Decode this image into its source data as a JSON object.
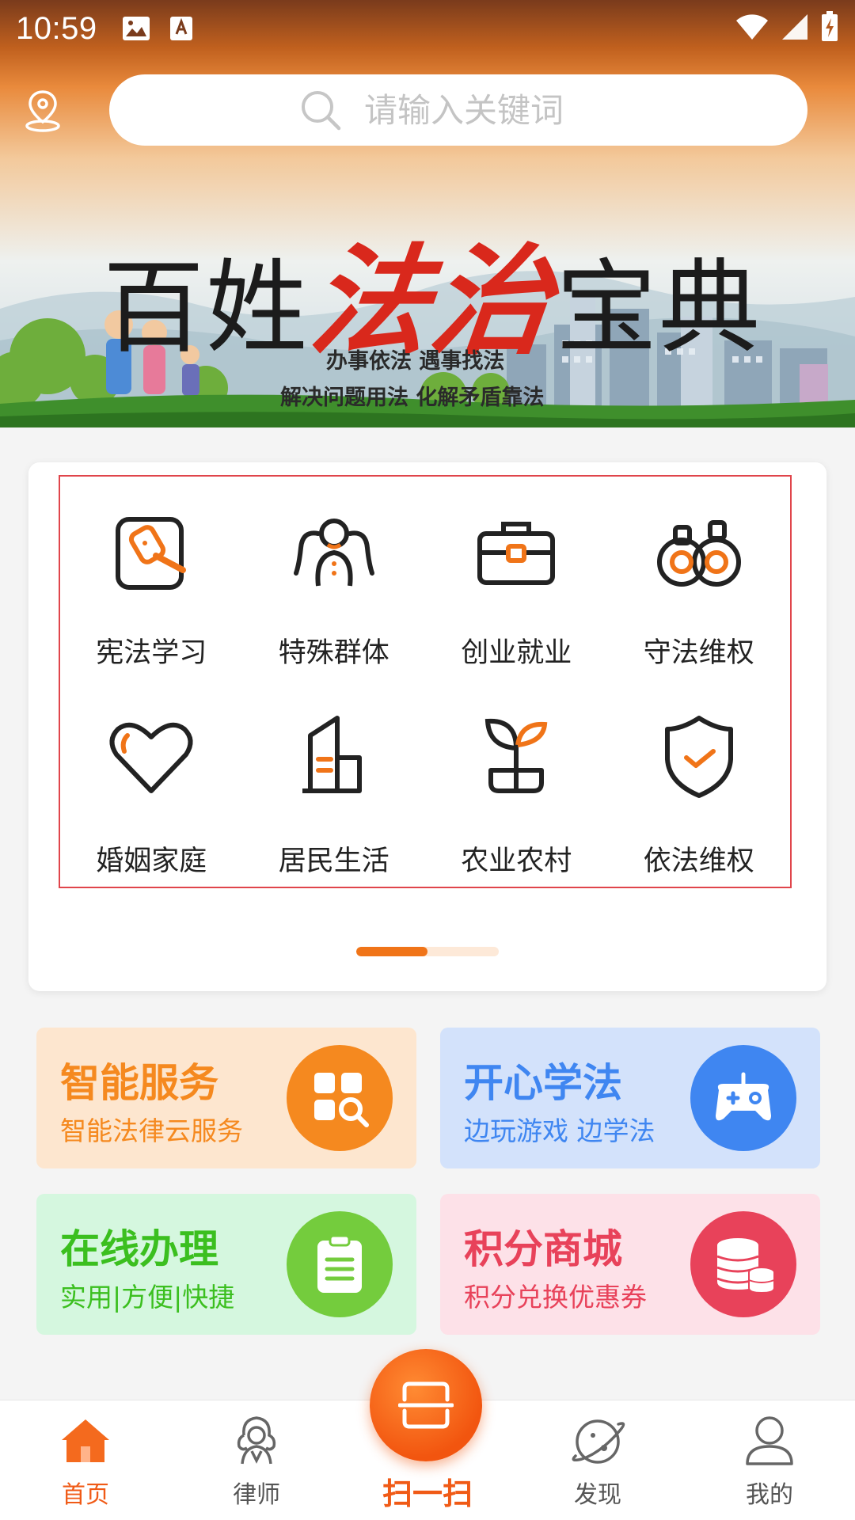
{
  "status_bar": {
    "time": "10:59"
  },
  "search": {
    "placeholder": "请输入关键词"
  },
  "banner": {
    "title_prefix": "百姓",
    "title_accent": "法治",
    "title_suffix": "宝典",
    "slogan_line1": "办事依法  遇事找法",
    "slogan_line2": "解决问题用法  化解矛盾靠法"
  },
  "categories": [
    {
      "label": "宪法学习",
      "icon": "gavel-icon"
    },
    {
      "label": "特殊群体",
      "icon": "group-icon"
    },
    {
      "label": "创业就业",
      "icon": "briefcase-icon"
    },
    {
      "label": "守法维权",
      "icon": "handcuffs-icon"
    },
    {
      "label": "婚姻家庭",
      "icon": "heart-icon"
    },
    {
      "label": "居民生活",
      "icon": "building-icon"
    },
    {
      "label": "农业农村",
      "icon": "sprout-icon"
    },
    {
      "label": "依法维权",
      "icon": "shield-check-icon"
    }
  ],
  "category_pager": {
    "pages": 2,
    "current": 1,
    "progress": 0.5
  },
  "features": [
    {
      "title": "智能服务",
      "subtitle": "智能法律云服务",
      "icon": "apps-search-icon",
      "color": "#f5891f",
      "bg": "#fde6cf"
    },
    {
      "title": "开心学法",
      "subtitle": "边玩游戏 边学法",
      "icon": "gamepad-icon",
      "color": "#3f86f1",
      "bg": "#d3e2fb"
    },
    {
      "title": "在线办理",
      "subtitle": "实用|方便|快捷",
      "icon": "clipboard-icon",
      "color": "#3bbf1f",
      "bg": "#d5f7df"
    },
    {
      "title": "积分商城",
      "subtitle": "积分兑换优惠券",
      "icon": "coins-icon",
      "color": "#e8425a",
      "bg": "#fde1e8"
    }
  ],
  "bottom_nav": {
    "home": "首页",
    "lawyer": "律师",
    "scan": "扫一扫",
    "discover": "发现",
    "mine": "我的"
  },
  "colors": {
    "accent": "#f05a16",
    "active_nav": "#f05a16"
  }
}
